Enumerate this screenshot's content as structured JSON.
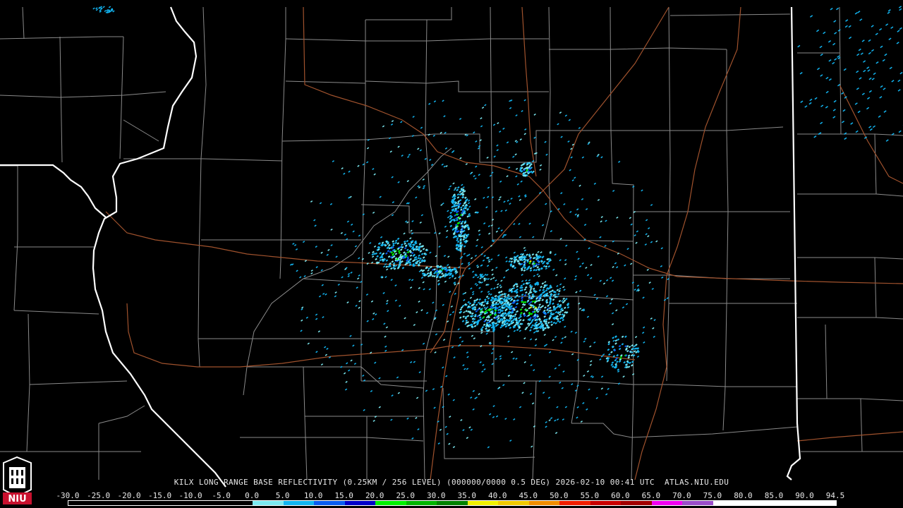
{
  "caption": "KILX LONG RANGE BASE REFLECTIVITY (0.25KM / 256 LEVEL) (000000/0000 0.5 DEG) 2026-02-10 00:41 UTC  ATLAS.NIU.EDU",
  "logo_text": "NIU",
  "scale": {
    "labels": [
      "-30.0",
      "-25.0",
      "-20.0",
      "-15.0",
      "-10.0",
      "-5.0",
      "0.0",
      "5.0",
      "10.0",
      "15.0",
      "20.0",
      "25.0",
      "30.0",
      "35.0",
      "40.0",
      "45.0",
      "50.0",
      "55.0",
      "60.0",
      "65.0",
      "70.0",
      "75.0",
      "80.0",
      "85.0",
      "90.0",
      "94.5"
    ],
    "colors": [
      "#000000",
      "#000000",
      "#000000",
      "#000000",
      "#000000",
      "#000000",
      "#7be8f0",
      "#12b4f0",
      "#0a5cf0",
      "#0000c8",
      "#00f000",
      "#00b400",
      "#008200",
      "#f0f000",
      "#f0c800",
      "#f08c00",
      "#f01e00",
      "#c80000",
      "#a00000",
      "#f000f0",
      "#9a4cc8",
      "#ffffff",
      "#ffffff",
      "#ffffff",
      "#ffffff"
    ]
  },
  "colors": {
    "county_lines": "#8a8a8a",
    "state_lines": "#ffffff",
    "highways": "#a0522d",
    "background": "#000000"
  }
}
